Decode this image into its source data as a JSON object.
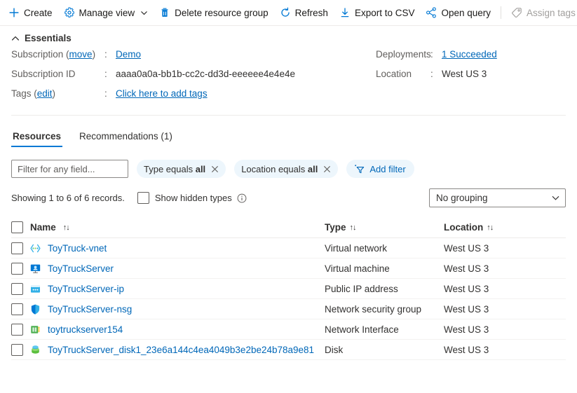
{
  "toolbar": {
    "items": [
      {
        "label": "Create",
        "icon": "plus-icon",
        "disabled": false,
        "chevron": false
      },
      {
        "label": "Manage view",
        "icon": "gear-icon",
        "disabled": false,
        "chevron": true
      },
      {
        "label": "Delete resource group",
        "icon": "trash-icon",
        "disabled": false,
        "chevron": false
      },
      {
        "label": "Refresh",
        "icon": "refresh-icon",
        "disabled": false,
        "chevron": false
      },
      {
        "label": "Export to CSV",
        "icon": "download-icon",
        "disabled": false,
        "chevron": false
      },
      {
        "label": "Open query",
        "icon": "query-graph-icon",
        "disabled": false,
        "chevron": false
      },
      {
        "label": "Assign tags",
        "icon": "tag-icon",
        "disabled": true,
        "chevron": false
      }
    ]
  },
  "essentials": {
    "title": "Essentials",
    "left": [
      {
        "label": "Subscription",
        "label_link": "move",
        "label_prefix": "Subscription (",
        "label_suffix": ")",
        "value": "Demo",
        "value_is_link": true
      },
      {
        "label": "Subscription ID",
        "value": "aaaa0a0a-bb1b-cc2c-dd3d-eeeeee4e4e4e",
        "value_is_link": false
      },
      {
        "label": "Tags",
        "label_link": "edit",
        "label_prefix": "Tags (",
        "label_suffix": ")",
        "value": "Click here to add tags",
        "value_is_link": true
      }
    ],
    "right": [
      {
        "label": "Deployments",
        "value": "1 Succeeded",
        "value_is_link": true
      },
      {
        "label": "Location",
        "value": "West US 3",
        "value_is_link": false
      }
    ]
  },
  "tabs": [
    {
      "label": "Resources",
      "active": true
    },
    {
      "label": "Recommendations (1)",
      "active": false
    }
  ],
  "filters": {
    "search_placeholder": "Filter for any field...",
    "search_value": "",
    "chips": [
      {
        "prefix": "Type equals ",
        "bold": "all"
      },
      {
        "prefix": "Location equals ",
        "bold": "all"
      }
    ],
    "add_filter_label": "Add filter"
  },
  "status": {
    "showing_text": "Showing 1 to 6 of 6 records.",
    "show_hidden_label": "Show hidden types",
    "show_hidden_checked": false,
    "grouping_value": "No grouping"
  },
  "table": {
    "headers": {
      "name": "Name",
      "type": "Type",
      "location": "Location"
    },
    "rows": [
      {
        "name": "ToyTruck-vnet",
        "type": "Virtual network",
        "location": "West US 3",
        "icon": "virtual-network-icon"
      },
      {
        "name": "ToyTruckServer",
        "type": "Virtual machine",
        "location": "West US 3",
        "icon": "virtual-machine-icon"
      },
      {
        "name": "ToyTruckServer-ip",
        "type": "Public IP address",
        "location": "West US 3",
        "icon": "public-ip-icon"
      },
      {
        "name": "ToyTruckServer-nsg",
        "type": "Network security group",
        "location": "West US 3",
        "icon": "network-security-group-icon"
      },
      {
        "name": "toytruckserver154",
        "type": "Network Interface",
        "location": "West US 3",
        "icon": "network-interface-icon"
      },
      {
        "name": "ToyTruckServer_disk1_23e6a144c4ea4049b3e2be24b78a9e81",
        "type": "Disk",
        "location": "West US 3",
        "icon": "disk-icon"
      }
    ]
  },
  "colors": {
    "accent": "#0078d4",
    "link": "#0067b8",
    "text": "#323130",
    "muted": "#605e5c",
    "chip_bg": "#edf6fc",
    "border": "#edebe9"
  }
}
